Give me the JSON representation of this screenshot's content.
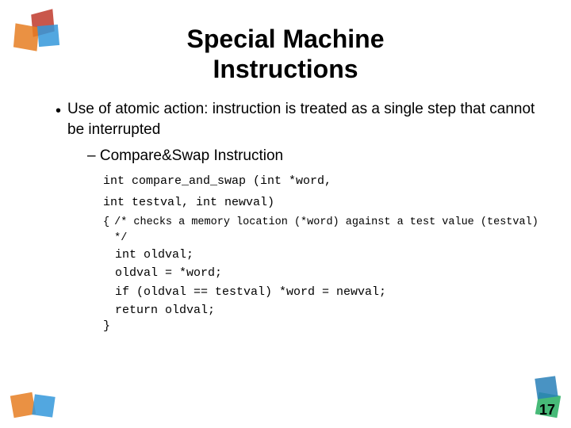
{
  "slide": {
    "title_line1": "Special Machine",
    "title_line2": "Instructions",
    "bullet1": "Use of atomic action: instruction is treated as a single step that cannot be interrupted",
    "subitem1": "– Compare&Swap Instruction",
    "code_line1": "int compare_and_swap (int *word,",
    "code_line2": "     int testval, int newval)",
    "code_comment": "/* checks a memory location (*word) against a test value (testval) */",
    "code_body1": "int oldval;",
    "code_body2": "oldval = *word;",
    "code_body3": "if (oldval == testval) *word = newval;",
    "code_body4": "return oldval;",
    "open_brace": "{",
    "close_brace": "}",
    "slide_number": "17"
  }
}
